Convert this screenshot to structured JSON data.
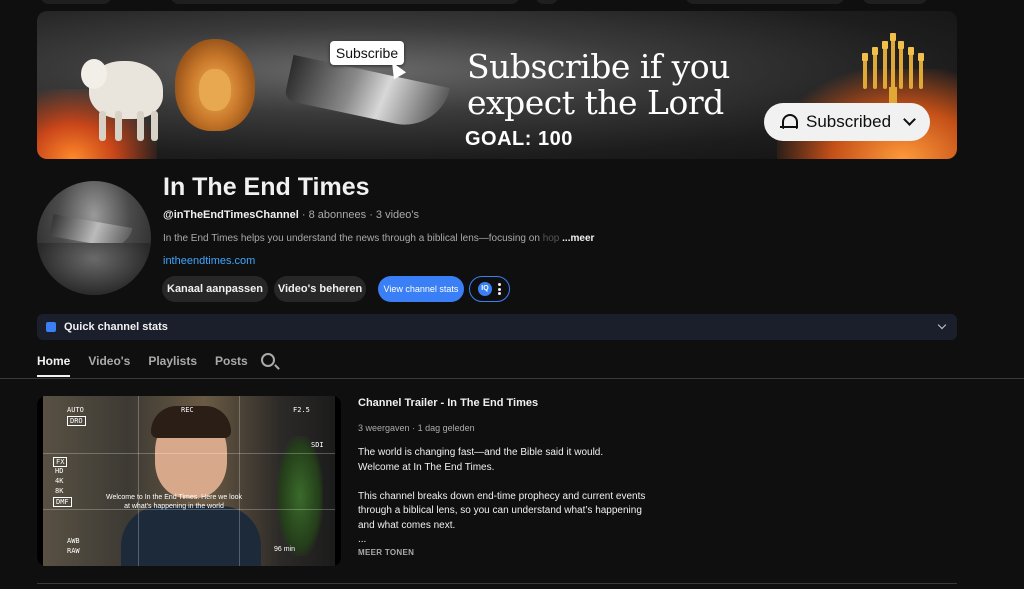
{
  "banner": {
    "subscribe_tag": "Subscribe",
    "tagline": "Subscribe if you expect the Lord",
    "goal": "GOAL: 100",
    "subscribed_label": "Subscribed"
  },
  "channel": {
    "name": "In The End Times",
    "handle": "@inTheEndTimesChannel",
    "subscribers": "8 abonnees",
    "videos": "3 video's",
    "separator": "·",
    "description": "In the End Times helps you understand the news through a biblical lens—focusing on ",
    "description_fade": "hop",
    "description_more": "...meer",
    "link": "intheendtimes.com"
  },
  "actions": {
    "customize": "Kanaal aanpassen",
    "manage_videos": "Video's beheren",
    "view_stats": "View channel stats",
    "vidiq_icon_text": "IQ"
  },
  "quick_stats": {
    "label": "Quick channel stats"
  },
  "tabs": [
    {
      "label": "Home",
      "active": true
    },
    {
      "label": "Video's",
      "active": false
    },
    {
      "label": "Playlists",
      "active": false
    },
    {
      "label": "Posts",
      "active": false
    }
  ],
  "trailer": {
    "title": "Channel Trailer - In The End Times",
    "views": "3 weergaven",
    "age": "1 dag geleden",
    "desc_line1": "The world is changing fast—and the Bible said it would.",
    "desc_line2": "Welcome at In The End Times.",
    "desc_line3": "This channel breaks down end-time prophecy and current events through a biblical lens, so you can understand what’s happening and what comes next.",
    "desc_ellipsis": "...",
    "show_more": "MEER TONEN",
    "caption": "Welcome to In the End Times. Here we look at what's happening in the world",
    "cam": {
      "auto": "AUTO",
      "dro": "DRO",
      "rec": "REC",
      "aperture": "F2.5",
      "sdi": "SDI",
      "fx": "FX",
      "hd": "HD",
      "k4": "4K",
      "k8": "8K",
      "dmf": "DMF",
      "awb": "AWB",
      "raw": "RAW",
      "battery": "96 min"
    }
  }
}
